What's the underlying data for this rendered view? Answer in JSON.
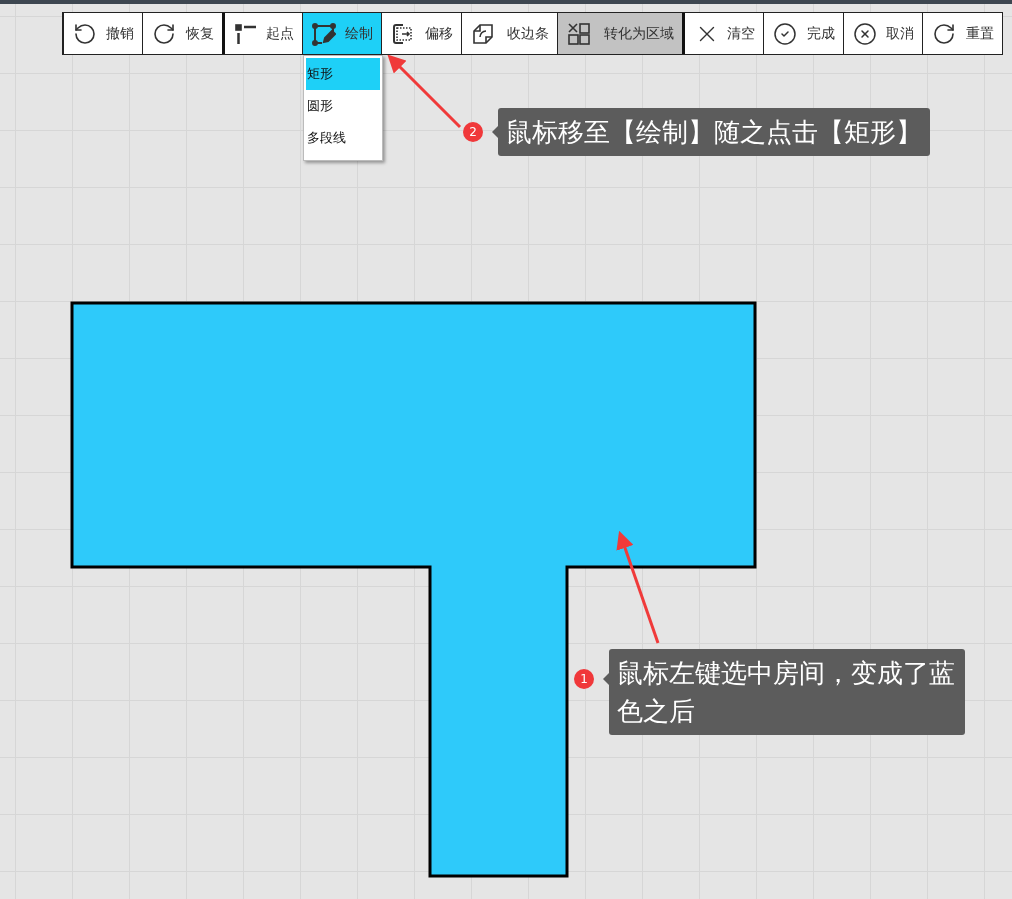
{
  "toolbar": [
    {
      "label": "撤销",
      "selected": false,
      "active": false,
      "group_start": false
    },
    {
      "label": "恢复",
      "selected": false,
      "active": false,
      "group_start": false
    },
    {
      "label": "起点",
      "selected": false,
      "active": false,
      "group_start": true
    },
    {
      "label": "绘制",
      "selected": true,
      "active": false,
      "group_start": false
    },
    {
      "label": "偏移",
      "selected": false,
      "active": false,
      "group_start": false
    },
    {
      "label": "收边条",
      "selected": false,
      "active": false,
      "group_start": false
    },
    {
      "label": "转化为区域",
      "selected": false,
      "active": true,
      "group_start": false
    },
    {
      "label": "清空",
      "selected": false,
      "active": false,
      "group_start": true
    },
    {
      "label": "完成",
      "selected": false,
      "active": false,
      "group_start": false
    },
    {
      "label": "取消",
      "selected": false,
      "active": false,
      "group_start": false
    },
    {
      "label": "重置",
      "selected": false,
      "active": false,
      "group_start": false
    }
  ],
  "draw_menu": [
    {
      "label": "矩形",
      "selected": true
    },
    {
      "label": "圆形",
      "selected": false
    },
    {
      "label": "多段线",
      "selected": false
    }
  ],
  "annotations": [
    {
      "number": "2",
      "text": "鼠标移至【绘制】随之点击【矩形】"
    },
    {
      "number": "1",
      "text": "鼠标左键选中房间，变成了蓝色之后"
    }
  ]
}
